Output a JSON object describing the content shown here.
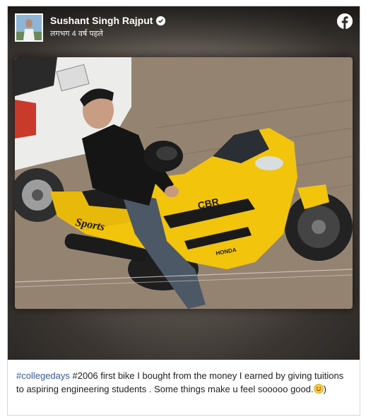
{
  "post": {
    "author": "Sushant Singh Rajput",
    "timestamp": "लगभग 4 वर्ष पहले",
    "caption": {
      "hashtag": "#collegedays",
      "text": " #2006 first bike I bought from the money I earned by giving tuitions to aspiring engineering students . Some things make u feel sooooo good.",
      "emoji": "slightly-smiling-face-icon",
      "trailing": ")"
    },
    "photo_text": {
      "bike_brand": "HONDA",
      "bike_tank_logo": "CBR",
      "bike_side": "Sports"
    }
  },
  "colors": {
    "hashtag": "#385898",
    "bike_yellow": "#f2c40c",
    "verified": "#ffffff"
  }
}
